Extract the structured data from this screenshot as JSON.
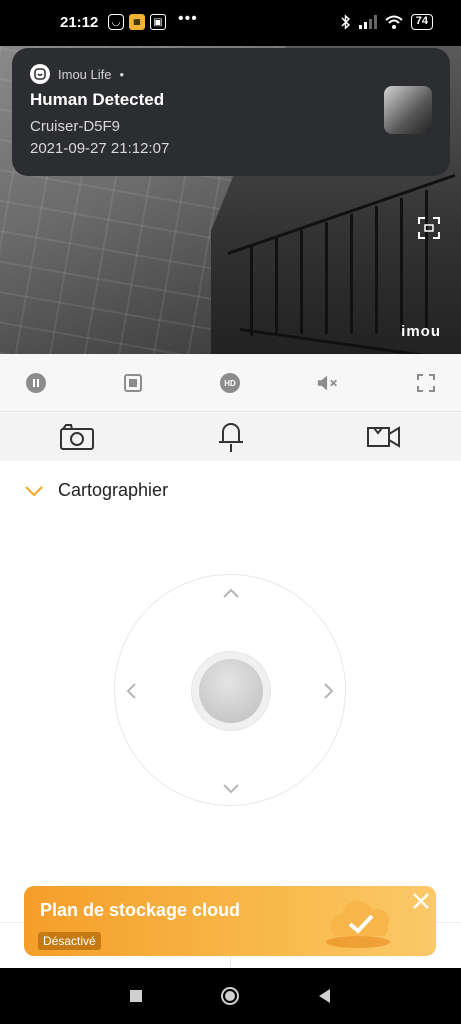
{
  "status_bar": {
    "time": "21:12",
    "battery": "74",
    "dots": "•••"
  },
  "notification": {
    "app_name": "Imou Life",
    "separator": "•",
    "title": "Human Detected",
    "device": "Cruiser-D5F9",
    "timestamp": "2021-09-27 21:12:07"
  },
  "video": {
    "watermark": "imou"
  },
  "controls": {
    "hd_label": "HD"
  },
  "section": {
    "label": "Cartographier"
  },
  "cloud_banner": {
    "title": "Plan de stockage cloud",
    "status": "Désactivé"
  },
  "colors": {
    "accent": "#f5a623",
    "notification_bg": "#2b2d30",
    "icon_gray": "#8c8c8c"
  }
}
